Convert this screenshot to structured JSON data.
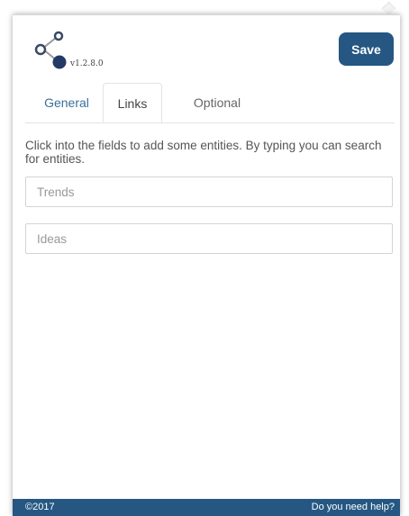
{
  "header": {
    "logo_icon": "share-node-icon",
    "version": "v1.2.8.0",
    "save_label": "Save"
  },
  "tabs": [
    {
      "label": "General",
      "active": false
    },
    {
      "label": "Links",
      "active": true
    },
    {
      "label": "Optional",
      "active": false
    }
  ],
  "content": {
    "instructions": "Click into the fields to add some entities. By typing you can search for entities.",
    "fields": [
      {
        "placeholder": "Trends",
        "value": ""
      },
      {
        "placeholder": "Ideas",
        "value": ""
      }
    ]
  },
  "footer": {
    "copyright": "©2017",
    "help_link": "Do you need help?"
  },
  "colors": {
    "brand": "#255782",
    "active_tab_text": "#3b6f98"
  }
}
